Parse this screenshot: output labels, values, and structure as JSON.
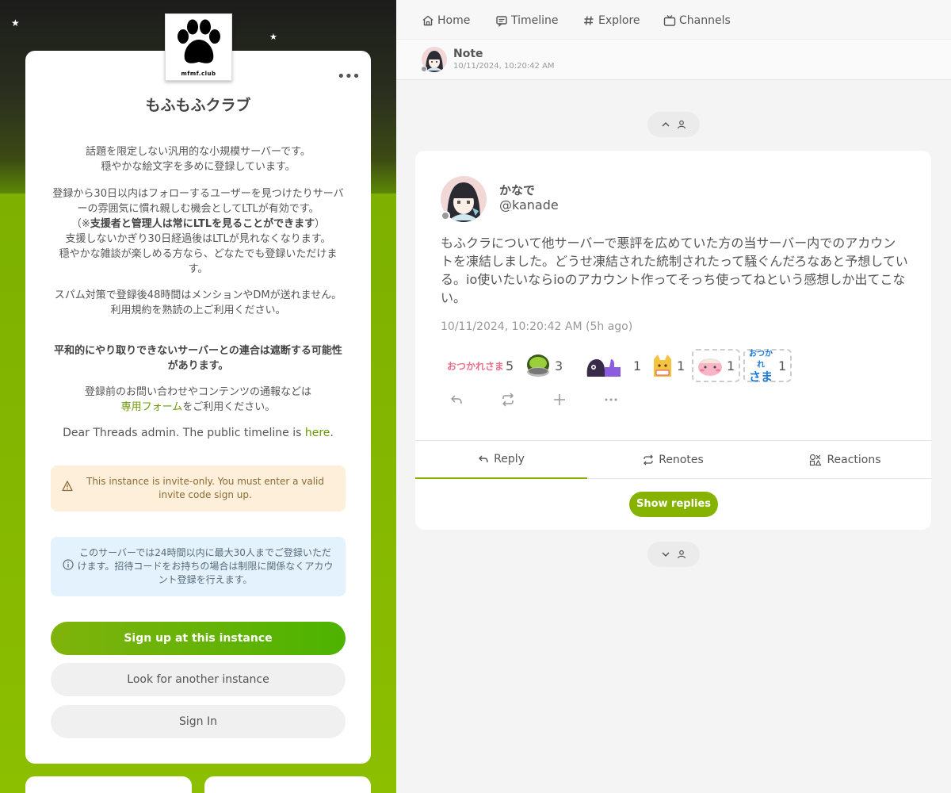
{
  "server": {
    "name": "もふもふクラブ",
    "logo_text": "mfmf.club",
    "more_icon": "more-icon",
    "description": [
      [
        "話題を限定しない汎用的な小規模サーバーです。",
        "穏やかな絵文字を多めに登録しています。"
      ],
      [
        "登録から30日以内はフォローするユーザーを見つけたりサーバーの雰囲気に慣れ親しむ機会としてLTLが有効です。"
      ],
      [
        "（※",
        "支援者と管理人は常にLTLを見ることができます",
        "）"
      ],
      [
        "支援しないかぎり30日経過後はLTLが見れなくなります。",
        "穏やかな雑談が楽しめる方なら、どなたでも登録いただけます。"
      ],
      [
        "スパム対策で登録後48時間はメンションやDMが送れません。",
        "利用規約を熟読の上ご利用ください。"
      ],
      [
        "平和的にやり取りできないサーバーとの連合は遮断する可能性があります。"
      ],
      [
        "登録前のお問い合わせやコンテンツの通報などは",
        "専用フォーム",
        "をご利用ください。"
      ],
      [
        "Dear Threads admin. The public timeline is ",
        "here",
        "."
      ]
    ],
    "notice_invite": "This instance is invite-only. You must enter a valid invite code sign up.",
    "notice_info": "このサーバーでは24時間以内に最大30人までご登録いただけます。招待コードをお持ちの場合は制限に関係なくアカウント登録を行えます。",
    "btn_signup": "Sign up at this instance",
    "btn_other": "Look for another instance",
    "btn_signin": "Sign In"
  },
  "nav": {
    "home": "Home",
    "timeline": "Timeline",
    "explore": "Explore",
    "channels": "Channels"
  },
  "header": {
    "title": "Note",
    "date": "10/11/2024, 10:20:42 AM"
  },
  "note": {
    "display_name": "かなで",
    "username": "@kanade",
    "text": "もふクラについて他サーバーで悪評を広めていた方の当サーバー内でのアカウントを凍結しました。どうせ凍結された統制されたって騒ぐんだろなあと予想している。io使いたいならioのアカウント作ってそっち使ってねという感想しか出てこない。",
    "time": "10/11/2024, 10:20:42 AM (5h ago)",
    "reactions": [
      {
        "label": "おつかれさま",
        "count": "5",
        "icon": "otsukaresama-emoji"
      },
      {
        "label": "",
        "count": "3",
        "icon": "tea-emoji"
      },
      {
        "label": "",
        "count": "1",
        "icon": "thumbs-up-character-emoji"
      },
      {
        "label": "",
        "count": "1",
        "icon": "cat-emoji"
      },
      {
        "label": "",
        "count": "1",
        "icon": "blush-face-emoji"
      },
      {
        "label": "おつかれさま",
        "count": "1",
        "icon": "otsukare-text-emoji"
      }
    ],
    "tabs": {
      "reply": "Reply",
      "renotes": "Renotes",
      "reactions": "Reactions"
    },
    "show_replies": "Show replies"
  },
  "colors": {
    "accent": "#86b300",
    "warn_bg": "#fdefd9",
    "info_bg": "#e3f2fd"
  }
}
